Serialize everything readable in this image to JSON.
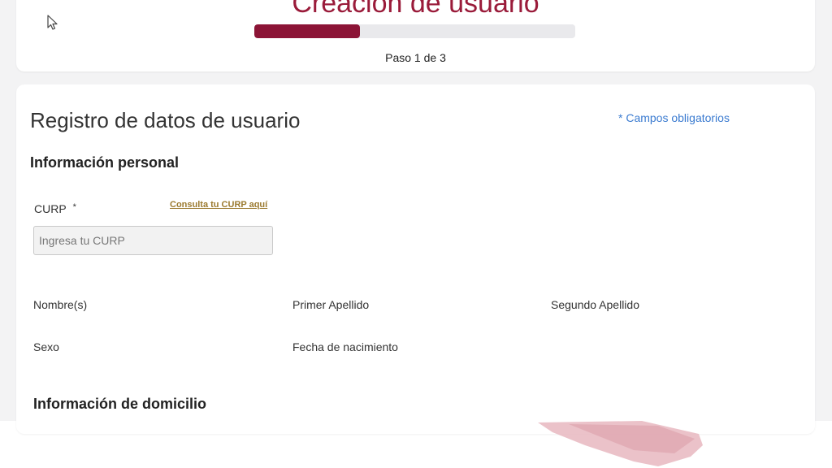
{
  "header": {
    "title": "Creación de usuario",
    "progress_fraction": 0.33,
    "step_label": "Paso 1 de 3"
  },
  "form": {
    "title": "Registro de datos de usuario",
    "required_note": "* Campos obligatorios",
    "personal": {
      "heading": "Información personal",
      "curp": {
        "label": "CURP",
        "required_mark": "*",
        "link": "Consulta tu CURP aquí",
        "placeholder": "Ingresa tu CURP",
        "value": ""
      },
      "fields": {
        "nombres": "Nombre(s)",
        "primer_apellido": "Primer Apellido",
        "segundo_apellido": "Segundo Apellido",
        "sexo": "Sexo",
        "fecha_nacimiento": "Fecha de nacimiento"
      }
    },
    "domicilio": {
      "heading": "Información de domicilio"
    }
  },
  "colors": {
    "brand": "#8c1436",
    "progress_track": "#e9e9ec",
    "link_gold": "#9b7a2f",
    "note_blue": "#3b7bd0"
  },
  "icons": {
    "cursor": "mouse-pointer-icon"
  }
}
